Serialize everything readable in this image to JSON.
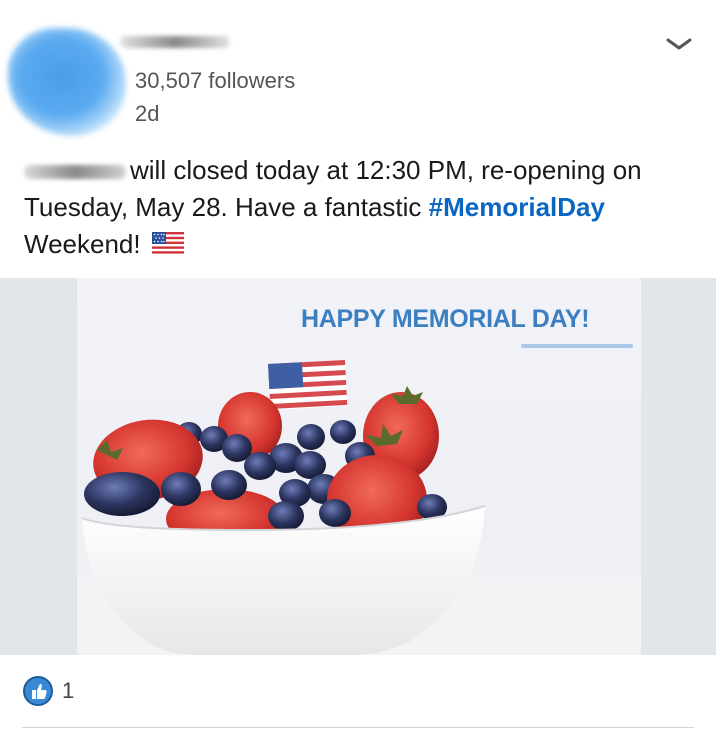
{
  "post": {
    "author": {
      "followers": "30,507 followers",
      "posted": "2d"
    },
    "text": {
      "line1": "will closed today at 12:30 PM, re-opening on",
      "line2": "Tuesday, May 28. Have a fantastic",
      "hashtag": "#MemorialDay",
      "line3": "Weekend!"
    },
    "media": {
      "headline": "HAPPY MEMORIAL DAY!"
    },
    "reactions": {
      "count": "1"
    }
  },
  "icons": {
    "menu": "chevron-down-icon",
    "like": "thumbs-up-icon",
    "emoji": "us-flag-icon"
  },
  "colors": {
    "hashtag": "#0a66c2",
    "headline": "#3b7fc0",
    "like_badge": "#3a89d6"
  }
}
